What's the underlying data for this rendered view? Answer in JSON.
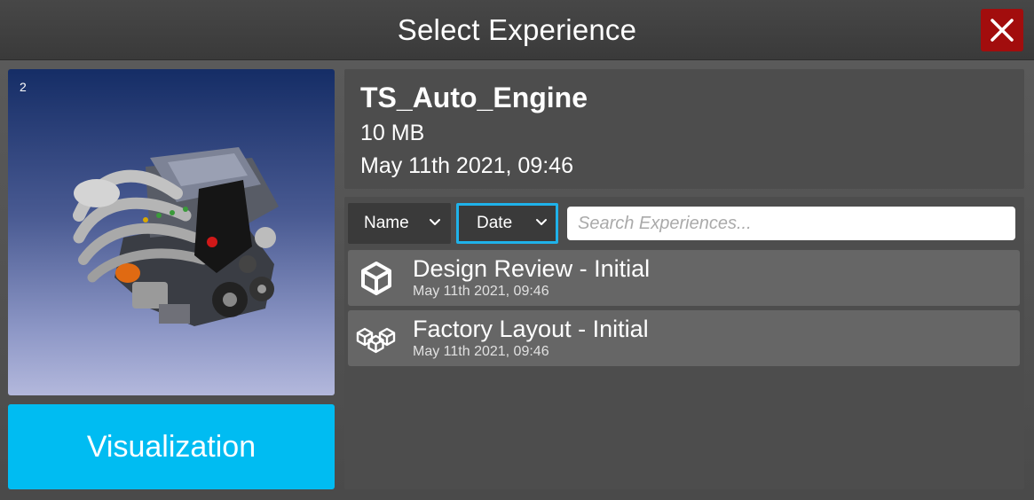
{
  "window": {
    "title": "Select Experience",
    "close_icon": "close-icon"
  },
  "preview": {
    "index": "2",
    "image": "engine-model-image"
  },
  "visualization_button": {
    "label": "Visualization"
  },
  "details": {
    "name": "TS_Auto_Engine",
    "size": "10 MB",
    "date": "May 11th 2021, 09:46"
  },
  "filters": {
    "sort_name": {
      "label": "Name",
      "icon": "chevron-down-icon"
    },
    "sort_date": {
      "label": "Date",
      "icon": "chevron-down-icon",
      "selected": true
    },
    "search": {
      "placeholder": "Search Experiences...",
      "value": ""
    }
  },
  "experiences": [
    {
      "name": "Design Review - Initial",
      "date": "May 11th 2021, 09:46",
      "icon": "cube-icon"
    },
    {
      "name": "Factory Layout - Initial",
      "date": "May 11th 2021, 09:46",
      "icon": "cubes-icon"
    }
  ],
  "colors": {
    "accent": "#00bcf2",
    "close": "#a20d0d",
    "selected_border": "#1fb2ea"
  }
}
